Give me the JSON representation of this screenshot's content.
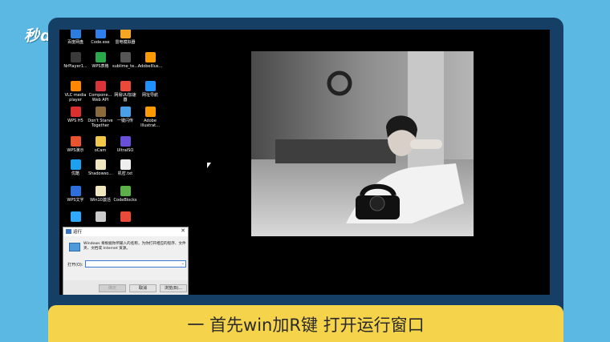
{
  "brand": "秒dong视频",
  "subtitle": "一 首先win加R键 打开运行窗口",
  "desktop": {
    "icons": [
      {
        "label": "百度网盘",
        "icon": "baidu-netdisk-icon",
        "color": "#2d7de0"
      },
      {
        "label": "Code.exe",
        "icon": "vscode-icon",
        "color": "#2f80ed"
      },
      {
        "label": "雷电模拟器",
        "icon": "ldplayer-icon",
        "color": "#f5a623"
      },
      {
        "label": "NrPlayer1...",
        "icon": "player-icon",
        "color": "#3a3a3a"
      },
      {
        "label": "WPS表格",
        "icon": "wps-sheet-icon",
        "color": "#2aa84a"
      },
      {
        "label": "sublime_te...",
        "icon": "sublime-icon",
        "color": "#555555"
      },
      {
        "label": "AdobeIllus...",
        "icon": "illustrator-icon",
        "color": "#ff9a00"
      },
      {
        "label": "VLC media\nplayer",
        "icon": "vlc-icon",
        "color": "#ff8800"
      },
      {
        "label": "Compone...\nWeb API",
        "icon": "component-icon",
        "color": "#d9343a"
      },
      {
        "label": "网易UU加速\n器",
        "icon": "uu-icon",
        "color": "#e94a3a"
      },
      {
        "label": "网址导航",
        "icon": "ie-icon",
        "color": "#1e90ff"
      },
      {
        "label": "WPS H5",
        "icon": "wps-h5-icon",
        "color": "#d92f2f"
      },
      {
        "label": "Don't Starve\nTogether",
        "icon": "dst-icon",
        "color": "#8a6a3a"
      },
      {
        "label": "一键闪传",
        "icon": "flash-transfer-icon",
        "color": "#4aa0e8"
      },
      {
        "label": "Adobe\nIllustrat...",
        "icon": "illustrator2-icon",
        "color": "#ff9a00"
      },
      {
        "label": "WPS演示",
        "icon": "wps-slides-icon",
        "color": "#e8542f"
      },
      {
        "label": "oCam",
        "icon": "ocam-icon",
        "color": "#f2c84b"
      },
      {
        "label": "UltraISO",
        "icon": "ultraiso-icon",
        "color": "#6a4fd8"
      },
      {
        "label": "优酷",
        "icon": "youku-icon",
        "color": "#1ea0f0"
      },
      {
        "label": "Shadowso...",
        "icon": "file-icon",
        "color": "#f0e6c0"
      },
      {
        "label": "机密.txt",
        "icon": "txt-icon",
        "color": "#eeeeee"
      },
      {
        "label": "WPS文字",
        "icon": "wps-writer-icon",
        "color": "#2f6fdc"
      },
      {
        "label": "Win10激活",
        "icon": "file2-icon",
        "color": "#f0e6c0"
      },
      {
        "label": "CodeBlocks",
        "icon": "codeblocks-icon",
        "color": "#5bb04a"
      },
      {
        "label": "",
        "icon": "ps-icon",
        "color": "#31a8ff"
      },
      {
        "label": "",
        "icon": "app-icon",
        "color": "#cccccc"
      },
      {
        "label": "",
        "icon": "app2-icon",
        "color": "#e94a3a"
      }
    ]
  },
  "run_dialog": {
    "title": "运行",
    "close": "✕",
    "description": "Windows 将根据你所输入的名称，为你打开相应的程序、文件夹、文档或 Internet 资源。",
    "open_label": "打开(O):",
    "open_value": "",
    "ok": "确定",
    "cancel": "取消",
    "browse": "浏览(B)..."
  }
}
